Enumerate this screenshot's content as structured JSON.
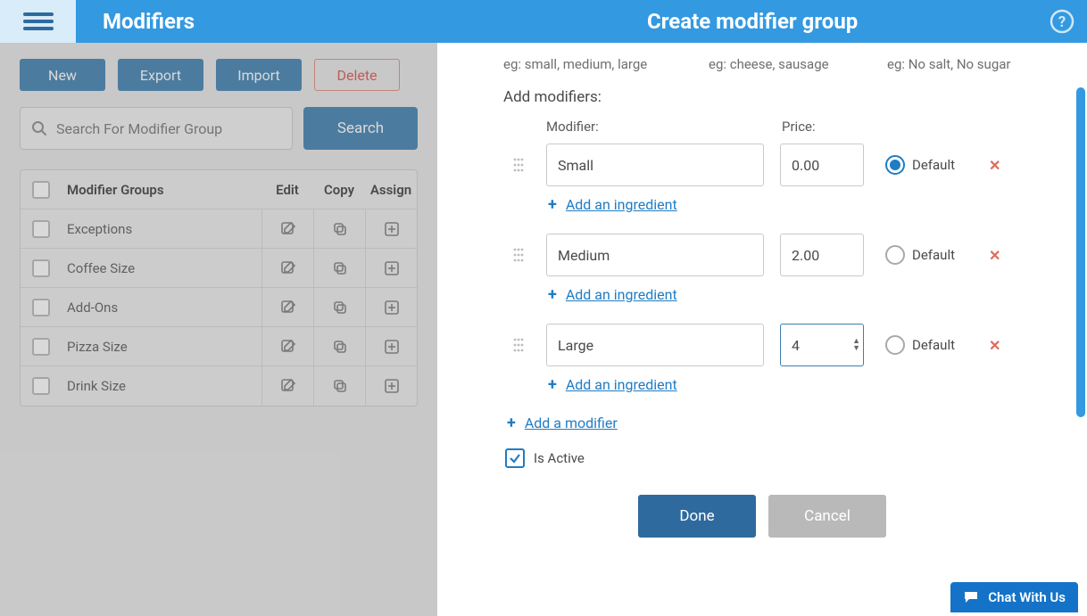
{
  "header": {
    "left_title": "Modifiers",
    "right_title": "Create modifier group"
  },
  "toolbar": {
    "new": "New",
    "export": "Export",
    "import": "Import",
    "delete": "Delete",
    "search_placeholder": "Search For Modifier Group",
    "search_btn": "Search"
  },
  "table": {
    "head_name": "Modifier Groups",
    "head_edit": "Edit",
    "head_copy": "Copy",
    "head_assign": "Assign",
    "rows": [
      {
        "name": "Exceptions"
      },
      {
        "name": "Coffee Size"
      },
      {
        "name": "Add-Ons"
      },
      {
        "name": "Pizza Size"
      },
      {
        "name": "Drink Size"
      }
    ]
  },
  "form": {
    "hints": {
      "a": "eg: small, medium, large",
      "b": "eg: cheese, sausage",
      "c": "eg: No salt, No sugar"
    },
    "section": "Add modifiers:",
    "col_modifier": "Modifier:",
    "col_price": "Price:",
    "default_label": "Default",
    "add_ingredient": "Add an ingredient",
    "add_modifier": "Add a modifier",
    "is_active": "Is Active",
    "done": "Done",
    "cancel": "Cancel",
    "modifiers": [
      {
        "name": "Small",
        "price": "0.00",
        "default": true,
        "focused": false
      },
      {
        "name": "Medium",
        "price": "2.00",
        "default": false,
        "focused": false
      },
      {
        "name": "Large",
        "price": "4",
        "default": false,
        "focused": true
      }
    ]
  },
  "chat": {
    "label": "Chat With Us"
  }
}
